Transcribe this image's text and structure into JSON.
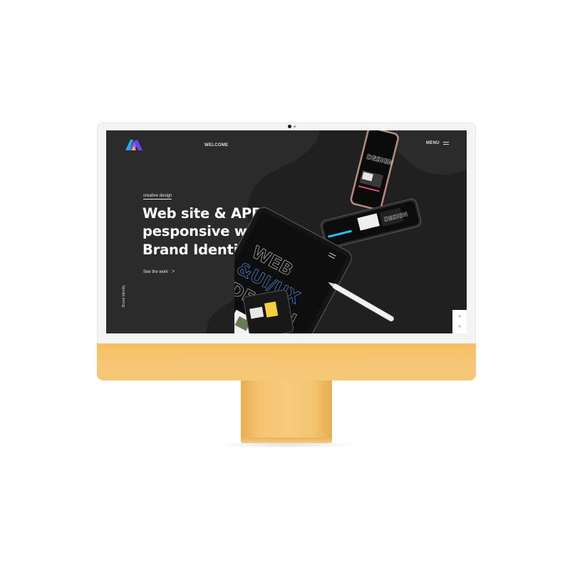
{
  "nav": {
    "welcome": "WELCOME",
    "menu": "MENU"
  },
  "hero": {
    "eyebrow": "creative design",
    "headline_line1": "Web site & APP,",
    "headline_line2": "pesponsive web and",
    "headline_line3": "Brand Identity",
    "cta": "See the work",
    "cta_arrow": ">"
  },
  "side_label": "Brand Identity",
  "scroll": {
    "next": ">",
    "prev": "<"
  },
  "mockup": {
    "tablet_text_1": "WEB",
    "tablet_text_2": "&UI/UX",
    "tablet_text_3": "DESIGN",
    "phone_text": "DESIGN"
  },
  "colors": {
    "screen_bg": "#2b2b2b",
    "blob": "#1f1f1f",
    "chin": "#f6c776",
    "logo_blue": "#27a9e1",
    "logo_purple": "#8b5cf6",
    "logo_yellow": "#f9c521"
  },
  "icons": {
    "logo": "logo-mark-icon",
    "menu": "hamburger-icon",
    "cta": "chevron-right-icon"
  }
}
